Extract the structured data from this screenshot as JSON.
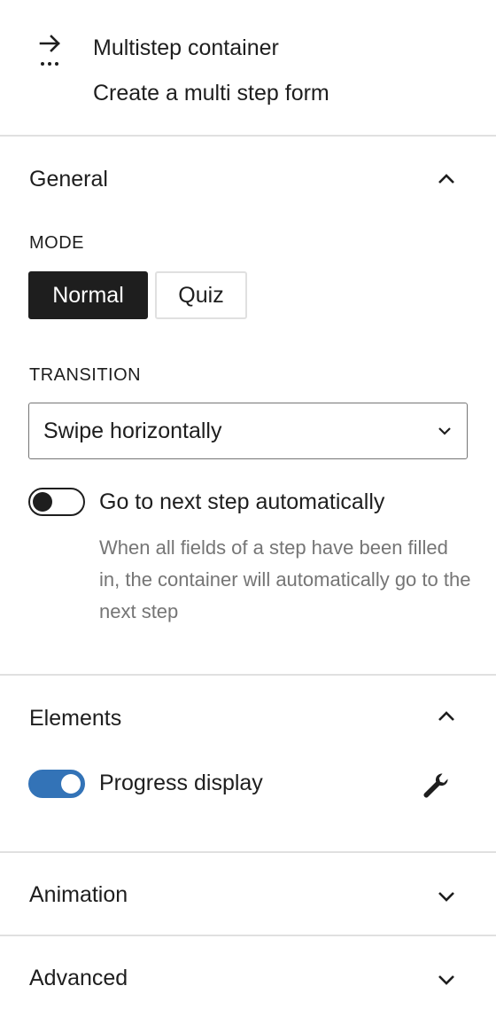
{
  "block": {
    "icon": "multistep-arrow-icon",
    "title": "Multistep container",
    "description": "Create a multi step form"
  },
  "general": {
    "title": "General",
    "expanded": true,
    "mode": {
      "label": "Mode",
      "options": [
        "Normal",
        "Quiz"
      ],
      "selected": "Normal"
    },
    "transition": {
      "label": "Transition",
      "value": "Swipe horizontally"
    },
    "auto_next": {
      "label": "Go to next step automatically",
      "enabled": false,
      "help": "When all fields of a step have been filled in, the container will automatically go to the next step"
    }
  },
  "elements": {
    "title": "Elements",
    "expanded": true,
    "progress_display": {
      "label": "Progress display",
      "enabled": true,
      "settings_icon": "wrench-icon"
    }
  },
  "animation": {
    "title": "Animation",
    "expanded": false
  },
  "advanced": {
    "title": "Advanced",
    "expanded": false
  },
  "colors": {
    "accent": "#3373b7",
    "text": "#1e1e1e",
    "muted": "#757575",
    "divider": "#e0e0e0"
  }
}
